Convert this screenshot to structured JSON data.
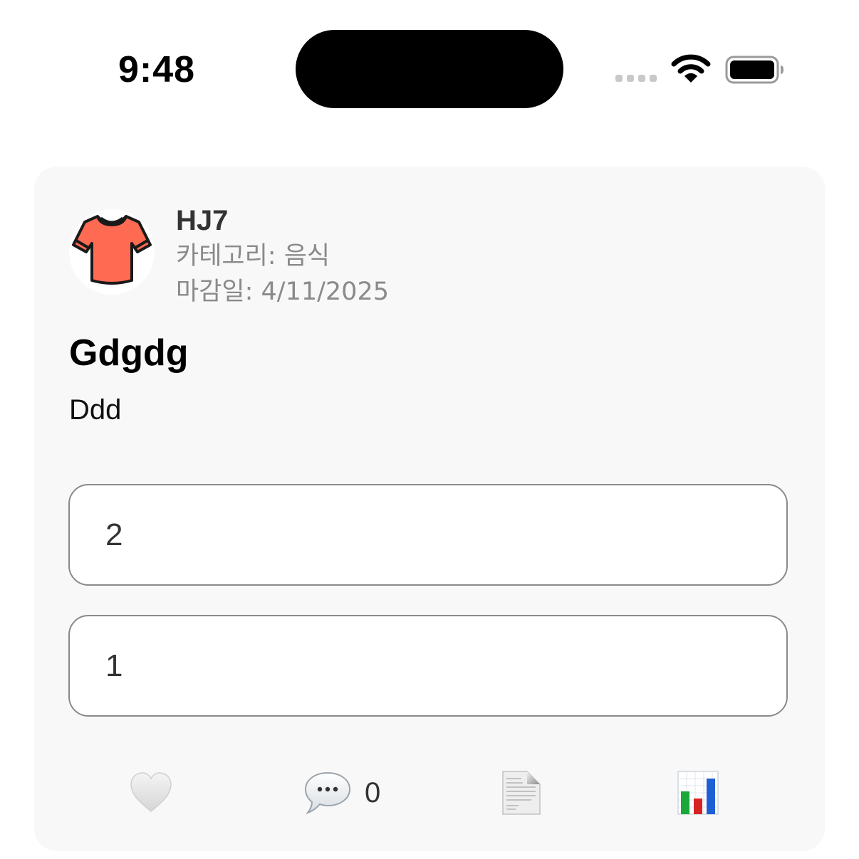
{
  "status_bar": {
    "time": "9:48",
    "wifi_icon": "wifi-icon",
    "battery_icon": "battery-full-icon"
  },
  "post": {
    "avatar_icon": "t-shirt-icon",
    "avatar_color": "#FF6B52",
    "author": "HJ7",
    "category_line": "카테고리: 음식",
    "deadline_line": "마감일: 4/11/2025",
    "title": "Gdgdg",
    "body": "Ddd",
    "options": [
      {
        "label": "2"
      },
      {
        "label": "1"
      }
    ]
  },
  "actions": {
    "like_icon": "white-heart-icon",
    "comment_icon": "speech-bubble-icon",
    "comment_count": "0",
    "document_icon": "document-icon",
    "stats_icon": "bar-chart-icon"
  },
  "colors": {
    "card_background": "#F8F8F8",
    "option_border": "#8A8A8A",
    "meta_text": "#8A8A8A"
  }
}
